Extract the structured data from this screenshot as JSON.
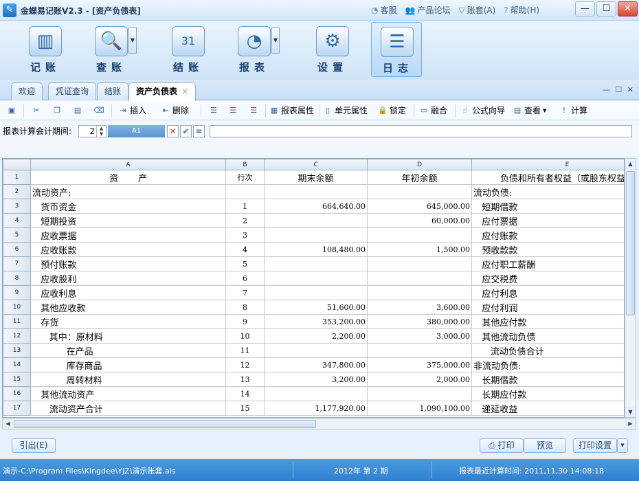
{
  "window": {
    "title": "金蝶易记账V2.3 - [资产负债表]",
    "links": [
      {
        "icon": "headset-icon",
        "label": "客服"
      },
      {
        "icon": "users-icon",
        "label": "产品论坛"
      },
      {
        "icon": "chevron-down-icon",
        "label": "账套(A)"
      },
      {
        "icon": "help-icon",
        "label": "帮助(H)"
      }
    ],
    "controls": {
      "minimize": "—",
      "maximize": "☐",
      "close": "✕"
    }
  },
  "toolbar": {
    "items": [
      {
        "label": "记账",
        "icon": "ledger-book-icon",
        "glyph": "▥",
        "dropdown": false
      },
      {
        "label": "查账",
        "icon": "magnifier-icon",
        "glyph": "🔍",
        "dropdown": true
      },
      {
        "label": "结账",
        "icon": "calendar-icon",
        "glyph": "31",
        "dropdown": false
      },
      {
        "label": "报表",
        "icon": "chart-icon",
        "glyph": "◔",
        "dropdown": true
      },
      {
        "label": "设置",
        "icon": "gear-icon",
        "glyph": "⚙",
        "dropdown": false
      },
      {
        "label": "日志",
        "icon": "log-icon",
        "glyph": "☰",
        "dropdown": false
      }
    ],
    "dropdown_glyph": "▼"
  },
  "tabs": [
    {
      "label": "欢迎",
      "active": false
    },
    {
      "label": "凭证查询",
      "active": false
    },
    {
      "label": "结账",
      "active": false
    },
    {
      "label": "资产负债表",
      "active": true
    }
  ],
  "tab_close": "×",
  "tab_controls": "— ☐ ✕",
  "editbar": {
    "insert": "插入",
    "delete": "删除",
    "report_props": "报表属性",
    "cell_props": "单元属性",
    "lock": "锁定",
    "merge": "融合",
    "formula_wizard": "公式向导",
    "view": "查看",
    "view_arrow": "▼",
    "calc": "计算"
  },
  "formula_bar": {
    "period_label": "报表计算会计期间:",
    "period_value": "2",
    "cell_ref": "A1",
    "cancel": "✕",
    "confirm": "✔",
    "equals": "=",
    "formula": ""
  },
  "sheet": {
    "columns": [
      "A",
      "B",
      "C",
      "D",
      "E"
    ],
    "rows": [
      {
        "n": "1",
        "a": "资       产",
        "b": "行次",
        "c": "期末余额",
        "d": "年初余额",
        "e": "负债和所有者权益（或股东权益）"
      },
      {
        "n": "2",
        "a": "流动资产:",
        "b": "",
        "c": "",
        "d": "",
        "e": "流动负债:"
      },
      {
        "n": "3",
        "a": "   货币资金",
        "b": "1",
        "c": "664,640.00",
        "d": "645,000.00",
        "e": "   短期借款"
      },
      {
        "n": "4",
        "a": "   短期投资",
        "b": "2",
        "c": "",
        "d": "60,000.00",
        "e": "   应付票据"
      },
      {
        "n": "5",
        "a": "   应收票据",
        "b": "3",
        "c": "",
        "d": "",
        "e": "   应付账款"
      },
      {
        "n": "6",
        "a": "   应收账款",
        "b": "4",
        "c": "108,480.00",
        "d": "1,500.00",
        "e": "   预收款款"
      },
      {
        "n": "7",
        "a": "   预付账款",
        "b": "5",
        "c": "",
        "d": "",
        "e": "   应付职工薪酬"
      },
      {
        "n": "8",
        "a": "   应收股利",
        "b": "6",
        "c": "",
        "d": "",
        "e": "   应交税费"
      },
      {
        "n": "9",
        "a": "   应收利息",
        "b": "7",
        "c": "",
        "d": "",
        "e": "   应付利息"
      },
      {
        "n": "10",
        "a": "   其他应收款",
        "b": "8",
        "c": "51,600.00",
        "d": "3,600.00",
        "e": "   应付利润"
      },
      {
        "n": "11",
        "a": "   存货",
        "b": "9",
        "c": "353,200.00",
        "d": "380,000.00",
        "e": "   其他应付款"
      },
      {
        "n": "12",
        "a": "      其中：原材料",
        "b": "10",
        "c": "2,200.00",
        "d": "3,000.00",
        "e": "   其他流动负债"
      },
      {
        "n": "13",
        "a": "            在产品",
        "b": "11",
        "c": "",
        "d": "",
        "e": "      流动负债合计"
      },
      {
        "n": "14",
        "a": "            库存商品",
        "b": "12",
        "c": "347,800.00",
        "d": "375,000.00",
        "e": "非流动负债:"
      },
      {
        "n": "15",
        "a": "            周转材料",
        "b": "13",
        "c": "3,200.00",
        "d": "2,000.00",
        "e": "   长期借款"
      },
      {
        "n": "16",
        "a": "   其他流动资产",
        "b": "14",
        "c": "",
        "d": "",
        "e": "   长期应付款"
      },
      {
        "n": "17",
        "a": "      流动资产合计",
        "b": "15",
        "c": "1,177,920.00",
        "d": "1,090,100.00",
        "e": "   递延收益"
      }
    ]
  },
  "bottom": {
    "quote": "引出(E)",
    "print": "打印",
    "preview": "预览",
    "print_setup": "打印设置",
    "arrow": "▼"
  },
  "status": {
    "path": "演示-C:\\Program Files\\Kingdee\\YJZ\\演示账套.ais",
    "period": "2012年  第 2 期",
    "last_calc": "报表最近计算时间: 2011,11,30 14:08:18"
  },
  "colors": {
    "accent": "#2f7fcf",
    "title_bg": "#d3e7f8",
    "cellref_bg": "#5e95cf"
  }
}
